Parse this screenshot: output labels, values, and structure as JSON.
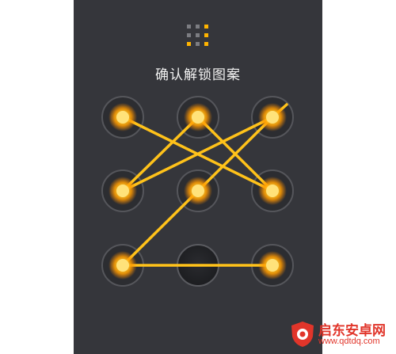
{
  "screen": {
    "title": "确认解锁图案",
    "background_color": "#35363b",
    "accent_color": "#ffb400",
    "line_color": "#ffc21a"
  },
  "pattern_indicator": {
    "icon": "pattern-grid-icon",
    "active": [
      false,
      false,
      true,
      false,
      false,
      true,
      true,
      false,
      true
    ]
  },
  "lock_pattern": {
    "dots": [
      {
        "id": 1,
        "active": true
      },
      {
        "id": 2,
        "active": true
      },
      {
        "id": 3,
        "active": true
      },
      {
        "id": 4,
        "active": true
      },
      {
        "id": 5,
        "active": true
      },
      {
        "id": 6,
        "active": true
      },
      {
        "id": 7,
        "active": true
      },
      {
        "id": 8,
        "active": false
      },
      {
        "id": 9,
        "active": true
      }
    ],
    "sequence": [
      1,
      6,
      2,
      4,
      3,
      5,
      7,
      9
    ]
  },
  "watermark": {
    "brand": "启东安卓网",
    "url": "www.qdtdq.com",
    "icon": "shield-logo-icon"
  }
}
